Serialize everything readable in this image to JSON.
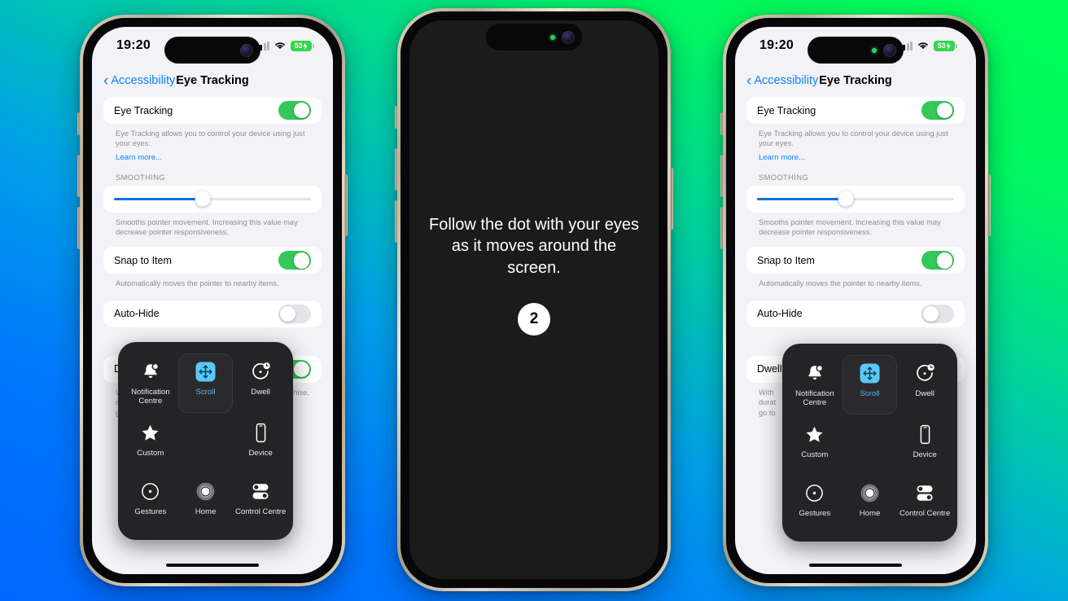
{
  "background": {
    "gradient_from": "#0066ff",
    "gradient_to": "#00ff55"
  },
  "phones": {
    "left": {
      "status_bar": {
        "time": "19:20",
        "battery_percent": "53",
        "battery_color": "#32d74b",
        "camera_active": false
      },
      "nav": {
        "back_label": "Accessibility",
        "title": "Eye Tracking"
      }
    },
    "right": {
      "status_bar": {
        "time": "19:20",
        "battery_percent": "53",
        "battery_color": "#32d74b",
        "camera_active": true
      },
      "nav": {
        "back_label": "Accessibility",
        "title": "Eye Tracking"
      }
    },
    "center": {
      "calibration_line1": "Follow the dot with your eyes",
      "calibration_line2": "as it moves around the screen.",
      "dot_number": "2"
    }
  },
  "settings": {
    "eye_tracking": {
      "label": "Eye Tracking",
      "enabled": true
    },
    "eye_tracking_footnote": "Eye Tracking allows you to control your device using just your eyes.",
    "learn_more": "Learn more...",
    "smoothing_header": "SMOOTHING",
    "smoothing_value": 45,
    "smoothing_footnote": "Smooths pointer movement. Increasing this value may decrease pointer responsiveness.",
    "snap_to_item": {
      "label": "Snap to Item",
      "enabled": true
    },
    "snap_footnote": "Automatically moves the pointer to nearby items.",
    "auto_hide": {
      "label": "Auto-Hide",
      "enabled": false
    },
    "dwell_control": {
      "label": "Dwell Control",
      "enabled": true
    },
    "dwell_footnote_l1": "With",
    "dwell_footnote_l2": "durat",
    "dwell_footnote_l3": "go to",
    "dwell_footnote_right": "hise,",
    "accent_blue": "#0a84ff",
    "toggle_on_color": "#34c759",
    "slider_fill_color": "#0a72e0"
  },
  "assistive_menu": {
    "selected": "Scroll",
    "selected_color": "#54b8f2",
    "background": "#242426",
    "items": [
      {
        "label": "Notification Centre",
        "icon": "bell-badge-icon"
      },
      {
        "label": "Scroll",
        "icon": "scroll-arrows-icon"
      },
      {
        "label": "Dwell",
        "icon": "dwell-timer-icon"
      },
      {
        "label": "Custom",
        "icon": "star-icon"
      },
      {
        "label": "",
        "icon": ""
      },
      {
        "label": "Device",
        "icon": "device-phone-icon"
      },
      {
        "label": "Gestures",
        "icon": "gestures-dot-icon"
      },
      {
        "label": "Home",
        "icon": "home-circle-icon"
      },
      {
        "label": "Control Centre",
        "icon": "control-centre-toggles-icon"
      }
    ]
  }
}
